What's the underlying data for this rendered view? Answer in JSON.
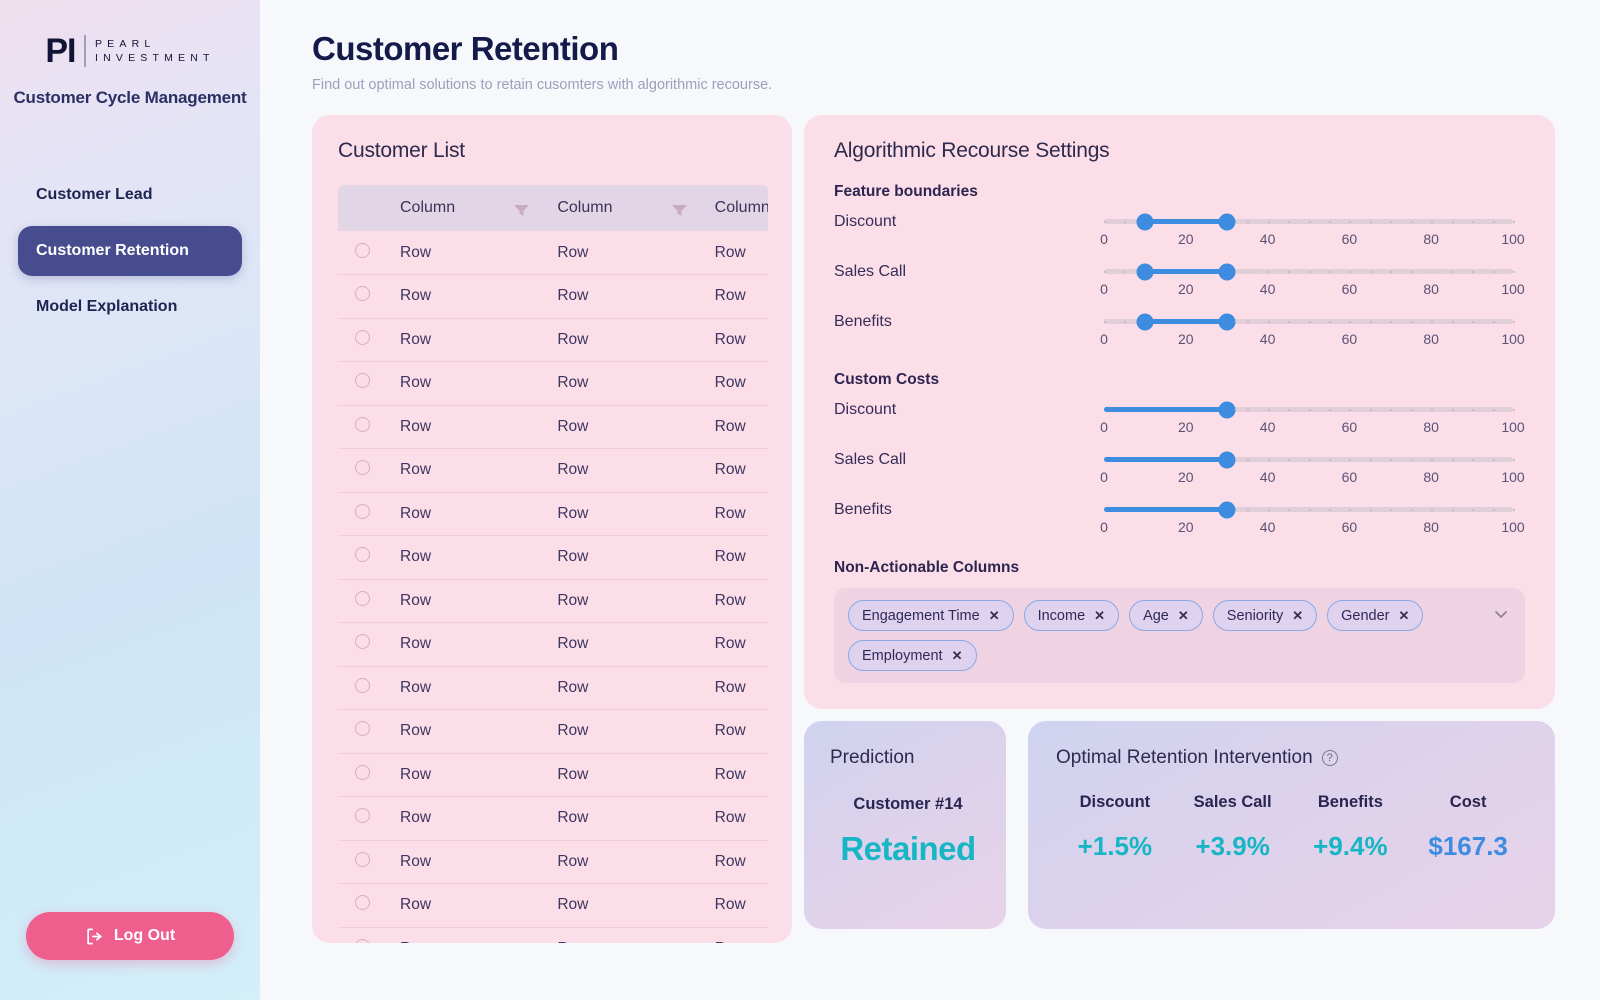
{
  "sidebar": {
    "logo": {
      "mark": "PI",
      "line1": "PEARL",
      "line2": "INVESTMENT"
    },
    "app_subtitle": "Customer Cycle Management",
    "nav": [
      {
        "label": "Customer Lead",
        "active": false
      },
      {
        "label": "Customer Retention",
        "active": true
      },
      {
        "label": "Model Explanation",
        "active": false
      }
    ],
    "logout_label": "Log Out"
  },
  "header": {
    "title": "Customer Retention",
    "subtitle": "Find out optimal solutions to retain cusomters with algorithmic recourse."
  },
  "customer_list": {
    "title": "Customer List",
    "columns": [
      "Column",
      "Column",
      "Column"
    ],
    "row_label": "Row",
    "row_count": 17
  },
  "settings": {
    "title": "Algorithmic Recourse Settings",
    "feature_boundaries": {
      "label": "Feature boundaries",
      "sliders": [
        {
          "label": "Discount",
          "type": "range",
          "min": 0,
          "max": 100,
          "low": 10,
          "high": 30
        },
        {
          "label": "Sales Call",
          "type": "range",
          "min": 0,
          "max": 100,
          "low": 10,
          "high": 30
        },
        {
          "label": "Benefits",
          "type": "range",
          "min": 0,
          "max": 100,
          "low": 10,
          "high": 30
        }
      ]
    },
    "custom_costs": {
      "label": "Custom Costs",
      "sliders": [
        {
          "label": "Discount",
          "type": "single",
          "min": 0,
          "max": 100,
          "value": 30
        },
        {
          "label": "Sales Call",
          "type": "single",
          "min": 0,
          "max": 100,
          "value": 30
        },
        {
          "label": "Benefits",
          "type": "single",
          "min": 0,
          "max": 100,
          "value": 30
        }
      ]
    },
    "tick_labels": [
      "0",
      "20",
      "40",
      "60",
      "80",
      "100"
    ],
    "non_actionable": {
      "label": "Non-Actionable Columns",
      "tags": [
        "Engagement Time",
        "Income",
        "Age",
        "Seniority",
        "Gender",
        "Employment"
      ],
      "remove_glyph": "✕"
    }
  },
  "prediction": {
    "title": "Prediction",
    "customer": "Customer #14",
    "value": "Retained"
  },
  "intervention": {
    "title": "Optimal Retention Intervention",
    "help_glyph": "?",
    "columns": [
      {
        "header": "Discount",
        "value": "+1.5%"
      },
      {
        "header": "Sales Call",
        "value": "+3.9%"
      },
      {
        "header": "Benefits",
        "value": "+9.4%"
      },
      {
        "header": "Cost",
        "value": "$167.3"
      }
    ]
  },
  "colors": {
    "accent_blue": "#3d8ce0",
    "teal": "#18b6c4",
    "pink_panel": "#fbdee8",
    "nav_active": "#474c8e",
    "logout_pink": "#ef5f8e"
  }
}
